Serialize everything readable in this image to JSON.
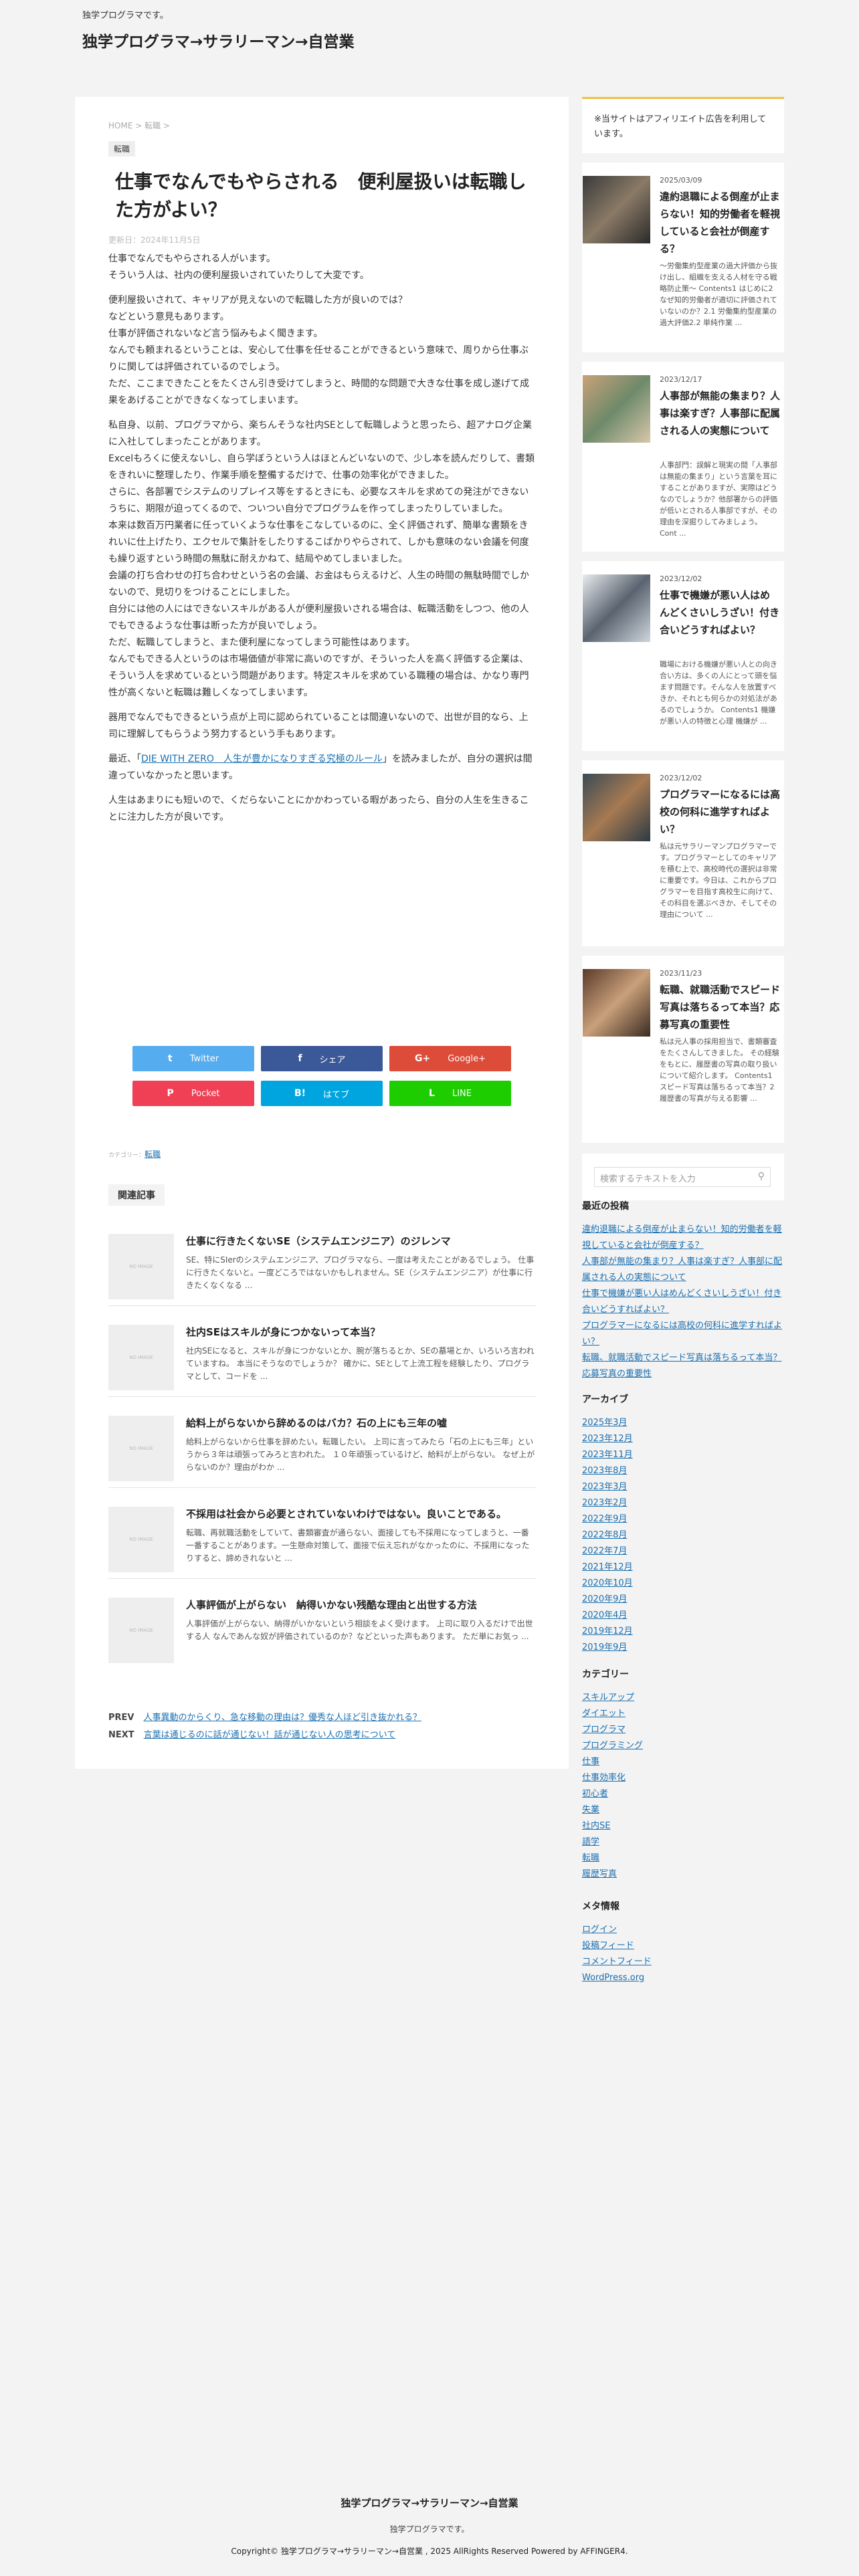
{
  "site": {
    "tagline": "独学プログラマです。",
    "title": "独学プログラマ→サラリーマン→自営業"
  },
  "article": {
    "breadcrumb": {
      "home": "HOME",
      "sep1": " > ",
      "cat": "転職",
      "sep2": " >"
    },
    "category": "転職",
    "title": "仕事でなんでもやらされる　便利屋扱いは転職した方がよい？",
    "date": "更新日：2024年11月5日",
    "paragraphs": [
      "仕事でなんでもやらされる人がいます。\nそういう人は、社内の便利屋扱いされていたりして大変です。",
      "便利屋扱いされて、キャリアが見えないので転職した方が良いのでは？\nなどという意見もあります。\n仕事が評価されないなど言う悩みもよく聞きます。\nなんでも頼まれるということは、安心して仕事を任せることができるという意味で、周りから仕事ぶりに関しては評価されているのでしょう。\nただ、ここまできたことをたくさん引き受けてしまうと、時間的な問題で大きな仕事を成し遂げて成果をあげることができなくなってしまいます。",
      "私自身、以前、プログラマから、楽ちんそうな社内SEとして転職しようと思ったら、超アナログ企業に入社してしまったことがあります。\nExcelもろくに使えないし、自ら学ぼうという人はほとんどいないので、少し本を読んだりして、書類をきれいに整理したり、作業手順を整備するだけで、仕事の効率化ができました。\nさらに、各部署でシステムのリプレイス等をするときにも、必要なスキルを求めての発注ができないうちに、期限が迫ってくるので、ついつい自分でプログラムを作ってしまったりしていました。\n本来は数百万円業者に任っていくような仕事をこなしているのに、全く評価されず、簡単な書類をきれいに仕上げたり、エクセルで集計をしたりするこばかりやらされて、しかも意味のない会議を何度も繰り返すという時間の無駄に耐えかねて、結局やめてしまいました。\n会議の打ち合わせの打ち合わせという名の会議、お金はもらえるけど、人生の時間の無駄時間でしかないので、見切りをつけることにしました。\n自分には他の人にはできないスキルがある人が便利屋扱いされる場合は、転職活動をしつつ、他の人でもできるような仕事は断った方が良いでしょう。\nただ、転職してしまうと、また便利屋になってしまう可能性はあります。\nなんでもできる人というのは市場価値が非常に高いのですが、そういった人を高く評価する企業は、そういう人を求めているという問題があります。特定スキルを求めている職種の場合は、かなり専門性が高くないと転職は難しくなってしまいます。",
      "器用でなんでもできるという点が上司に認められていることは間違いないので、出世が目的なら、上司に理解してもらうよう努力するという手もあります。"
    ],
    "link_para": {
      "pre": "最近、「",
      "link": "DIE WITH ZERO　人生が豊かになりすぎる究極のルール",
      "post": "」を読みましたが、自分の選択は間違っていなかったと思います。"
    },
    "last_para": "人生はあまりにも短いので、くだらないことにかかわっている暇があったら、自分の人生を生きることに注力した方が良いです。"
  },
  "share": [
    {
      "icon": "t",
      "label": "Twitter",
      "color": "#55acee"
    },
    {
      "icon": "f",
      "label": "シェア",
      "color": "#3b5998"
    },
    {
      "icon": "G+",
      "label": "Google+",
      "color": "#dd4b39"
    },
    {
      "icon": "P",
      "label": "Pocket",
      "color": "#ef4056"
    },
    {
      "icon": "B!",
      "label": "はてブ",
      "color": "#00a4de"
    },
    {
      "icon": "L",
      "label": "LINE",
      "color": "#1dcd00"
    }
  ],
  "post_category": {
    "prefix": "カテゴリー：",
    "link": "転職"
  },
  "related": {
    "heading": "関連記事",
    "no_image": "NO IMAGE",
    "items": [
      {
        "title": "仕事に行きたくないSE（システムエンジニア）のジレンマ",
        "desc": "SE、特にSIerのシステムエンジニア、プログラマなら、一度は考えたことがあるでしょう。 仕事に行きたくないと。一度どころではないかもしれません。SE（システムエンジニア）が仕事に行きたくなくなる ..."
      },
      {
        "title": "社内SEはスキルが身につかないって本当？",
        "desc": "社内SEになると、スキルが身につかないとか、腕が落ちるとか、SEの墓場とか、いろいろ言われていますね。 本当にそうなのでしょうか？ 確かに、SEとして上流工程を経験したり、プログラマとして、コードを ..."
      },
      {
        "title": "給料上がらないから辞めるのはバカ？石の上にも三年の嘘",
        "desc": "給料上がらないから仕事を辞めたい。転職したい。 上司に言ってみたら「石の上にも三年」というから３年は頑張ってみろと言われた。 １０年頑張っているけど、給料が上がらない。 なぜ上がらないのか？理由がわか ..."
      },
      {
        "title": "不採用は社会から必要とされていないわけではない。良いことである。",
        "desc": "転職、再就職活動をしていて、書類審査が通らない、面接しても不採用になってしまうと、一番一番することがあります。一生懸命対策して、面接で伝え忘れがなかったのに、不採用になったりすると、諦めきれないと ..."
      },
      {
        "title": "人事評価が上がらない　納得いかない残酷な理由と出世する方法",
        "desc": "人事評価が上がらない、納得がいかないという相談をよく受けます。 上司に取り入るだけで出世する人 なんであんな奴が評価されているのか？などといった声もあります。 ただ単にお気っ ..."
      }
    ]
  },
  "prev_next": {
    "prev_label": "PREV",
    "prev_link": "人事異動のからくり、急な移動の理由は？優秀な人ほど引き抜かれる？",
    "next_label": "NEXT",
    "next_link": "言葉は通じるのに話が通じない！話が通じない人の思考について"
  },
  "sidebar": {
    "ad_note": "※当サイトはアフィリエイト広告を利用しています。",
    "cards": [
      {
        "date": "2025/03/09",
        "title": "違約退職による倒産が止まらない！知的労働者を軽視していると会社が倒産する？",
        "excerpt": "〜労働集約型産業の過大評価から抜け出し、組織を支える人材を守る戦略防止策〜 Contents1 はじめに2 なぜ知的労働者が適切に評価されていないのか？2.1 労働集約型産業の過大評価2.2 単純作業 ..."
      },
      {
        "date": "2023/12/17",
        "title": "人事部が無能の集まり？人事は楽すぎ？人事部に配属される人の実態について",
        "excerpt": "人事部門：誤解と現実の間「人事部は無能の集まり」という言葉を耳にすることがありますが、実際はどうなのでしょうか？他部署からの評価が低いとされる人事部ですが、その理由を深掘りしてみましょう。 Cont ..."
      },
      {
        "date": "2023/12/02",
        "title": "仕事で機嫌が悪い人はめんどくさいしうざい！付き合いどうすればよい？",
        "excerpt": "職場における機嫌が悪い人との向き合い方は、多くの人にとって頭を悩ます問題です。そんな人を放置すべきか、それとも何らかの対処法があるのでしょうか。 Contents1 機嫌が悪い人の特徴と心理 機嫌が ..."
      },
      {
        "date": "2023/12/02",
        "title": "プログラマーになるには高校の何科に進学すればよい？",
        "excerpt": "私は元サラリーマンプログラマーです。プログラマーとしてのキャリアを積む上で、高校時代の選択は非常に重要です。今日は、これからプログラマーを目指す高校生に向けて、その科目を選ぶべきか、そしてその理由について ..."
      },
      {
        "date": "2023/11/23",
        "title": "転職、就職活動でスピード写真は落ちるって本当？応募写真の重要性",
        "excerpt": "私は元人事の採用担当で、書類審査をたくさんしてきました。 その経験をもとに、履歴書の写真の取り扱いについて紹介します。 Contents1 スピード写真は落ちるって本当？2 履歴書の写真が与える影響 ..."
      }
    ],
    "search_placeholder": "検索するテキストを入力",
    "recent": {
      "heading": "最近の投稿",
      "links": [
        "違約退職による倒産が止まらない！知的労働者を軽視していると会社が倒産する？",
        "人事部が無能の集まり？人事は楽すぎ？人事部に配属される人の実態について",
        "仕事で機嫌が悪い人はめんどくさいしうざい！付き合いどうすればよい？",
        "プログラマーになるには高校の何科に進学すればよい？",
        "転職、就職活動でスピード写真は落ちるって本当？応募写真の重要性"
      ]
    },
    "archives": {
      "heading": "アーカイブ",
      "links": [
        "2025年3月",
        "2023年12月",
        "2023年11月",
        "2023年8月",
        "2023年3月",
        "2023年2月",
        "2022年9月",
        "2022年8月",
        "2022年7月",
        "2021年12月",
        "2020年10月",
        "2020年9月",
        "2020年4月",
        "2019年12月",
        "2019年9月"
      ]
    },
    "categories": {
      "heading": "カテゴリー",
      "links": [
        "スキルアップ",
        "ダイエット",
        "プログラマ",
        "プログラミング",
        "仕事",
        "仕事効率化",
        "初心者",
        "失業",
        "社内SE",
        "語学",
        "転職",
        "履歴写真"
      ]
    },
    "meta": {
      "heading": "メタ情報",
      "links": [
        "ログイン",
        "投稿フィード",
        "コメントフィード",
        "WordPress.org"
      ]
    }
  },
  "footer": {
    "title": "独学プログラマ→サラリーマン→自営業",
    "tagline": "独学プログラマです。",
    "copyright": "Copyright© 独学プログラマ→サラリーマン→自営業 , 2025 AllRights Reserved Powered by AFFINGER4."
  }
}
